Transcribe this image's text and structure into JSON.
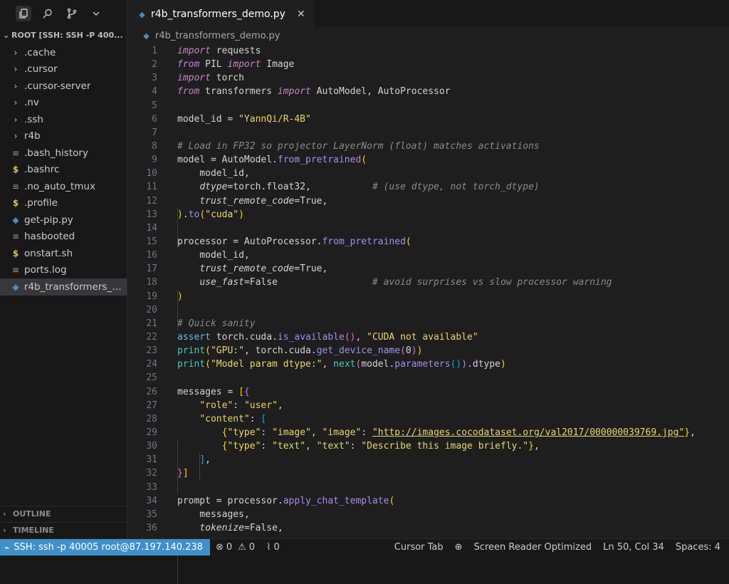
{
  "sidebar": {
    "title": "ROOT [SSH: SSH -P 400...",
    "items": [
      {
        "label": ".cache",
        "icon": "chevron-right-icon",
        "kind": "folder"
      },
      {
        "label": ".cursor",
        "icon": "chevron-right-icon",
        "kind": "folder"
      },
      {
        "label": ".cursor-server",
        "icon": "chevron-right-icon",
        "kind": "folder"
      },
      {
        "label": ".nv",
        "icon": "chevron-right-icon",
        "kind": "folder"
      },
      {
        "label": ".ssh",
        "icon": "chevron-right-icon",
        "kind": "folder"
      },
      {
        "label": "r4b",
        "icon": "chevron-right-icon",
        "kind": "folder"
      },
      {
        "label": ".bash_history",
        "icon": "lines-file-icon",
        "kind": "file"
      },
      {
        "label": ".bashrc",
        "icon": "dollar-file-icon",
        "kind": "file"
      },
      {
        "label": ".no_auto_tmux",
        "icon": "lines-file-icon",
        "kind": "file"
      },
      {
        "label": ".profile",
        "icon": "dollar-file-icon",
        "kind": "file"
      },
      {
        "label": "get-pip.py",
        "icon": "python-file-icon",
        "kind": "file"
      },
      {
        "label": "hasbooted",
        "icon": "lines-file-icon",
        "kind": "file"
      },
      {
        "label": "onstart.sh",
        "icon": "dollar-file-icon",
        "kind": "file"
      },
      {
        "label": "ports.log",
        "icon": "lines-file-icon",
        "kind": "file"
      },
      {
        "label": "r4b_transformers_d...",
        "icon": "python-file-icon",
        "kind": "file",
        "selected": true
      }
    ],
    "outline_label": "OUTLINE",
    "timeline_label": "TIMELINE"
  },
  "tab": {
    "label": "r4b_transformers_demo.py",
    "close": "✕"
  },
  "breadcrumb": "r4b_transformers_demo.py",
  "code_lines": [
    "1",
    "2",
    "3",
    "4",
    "5",
    "6",
    "7",
    "8",
    "9",
    "10",
    "11",
    "12",
    "13",
    "14",
    "15",
    "16",
    "17",
    "18",
    "19",
    "20",
    "21",
    "22",
    "23",
    "24",
    "25",
    "26",
    "27",
    "28",
    "29",
    "30",
    "31",
    "32",
    "33",
    "34",
    "35",
    "36"
  ],
  "code": {
    "l1": [
      "import",
      " requests"
    ],
    "l2": [
      "from",
      " PIL ",
      "import",
      " Image"
    ],
    "l3": [
      "import",
      " torch"
    ],
    "l4": [
      "from",
      " transformers ",
      "import",
      " AutoModel, AutoProcessor"
    ],
    "l6": [
      "model_id = ",
      "\"YannQi/R-4B\""
    ],
    "l8": "# Load in FP32 so projector LayerNorm (float) matches activations",
    "l9": [
      "model = AutoModel.",
      "from_pretrained",
      "("
    ],
    "l10": "    model_id,",
    "l11": [
      "    ",
      "dtype",
      "=torch.float32,           ",
      "# (use dtype, not torch_dtype)"
    ],
    "l12": [
      "    ",
      "trust_remote_code",
      "=True,"
    ],
    "l13": [
      ")",
      ".",
      "to",
      "(",
      "\"cuda\"",
      ")"
    ],
    "l15": [
      "processor = AutoProcessor.",
      "from_pretrained",
      "("
    ],
    "l16": "    model_id,",
    "l17": [
      "    ",
      "trust_remote_code",
      "=True,"
    ],
    "l18": [
      "    ",
      "use_fast",
      "=False                 ",
      "# avoid surprises vs slow processor warning"
    ],
    "l19": ")",
    "l21": "# Quick sanity",
    "l22": [
      "assert",
      " torch.cuda.",
      "is_available",
      "()",
      ", ",
      "\"CUDA not available\""
    ],
    "l23": [
      "print",
      "(",
      "\"GPU:\"",
      ", torch.cuda.",
      "get_device_name",
      "(",
      "0",
      ")",
      ")"
    ],
    "l24": [
      "print",
      "(",
      "\"Model param dtype:\"",
      ", ",
      "next",
      "(",
      "model.",
      "parameters",
      "()",
      ")",
      ".dtype",
      ")"
    ],
    "l26": [
      "messages = ",
      "[",
      "{"
    ],
    "l27": [
      "    ",
      "\"role\"",
      ": ",
      "\"user\"",
      ","
    ],
    "l28": [
      "    ",
      "\"content\"",
      ": ",
      "["
    ],
    "l29": [
      "        ",
      "{",
      "\"type\"",
      ": ",
      "\"image\"",
      ", ",
      "\"image\"",
      ": ",
      "\"http://images.cocodataset.org/val2017/000000039769.jpg\"",
      "}",
      ","
    ],
    "l30": [
      "        ",
      "{",
      "\"type\"",
      ": ",
      "\"text\"",
      ", ",
      "\"text\"",
      ": ",
      "\"Describe this image briefly.\"",
      "}",
      ","
    ],
    "l31": [
      "    ",
      "]",
      ","
    ],
    "l32": [
      "}",
      "]"
    ],
    "l34": [
      "prompt = processor.",
      "apply_chat_template",
      "("
    ],
    "l35": "    messages,",
    "l36": [
      "    ",
      "tokenize",
      "=False,"
    ]
  },
  "status": {
    "remote": "SSH: ssh -p 40005 root@87.197.140.238",
    "errors": "0",
    "warnings": "0",
    "ports": "0",
    "cursor_tab": "Cursor Tab",
    "screen_reader": "Screen Reader Optimized",
    "position": "Ln 50, Col 34",
    "spaces": "Spaces: 4"
  }
}
